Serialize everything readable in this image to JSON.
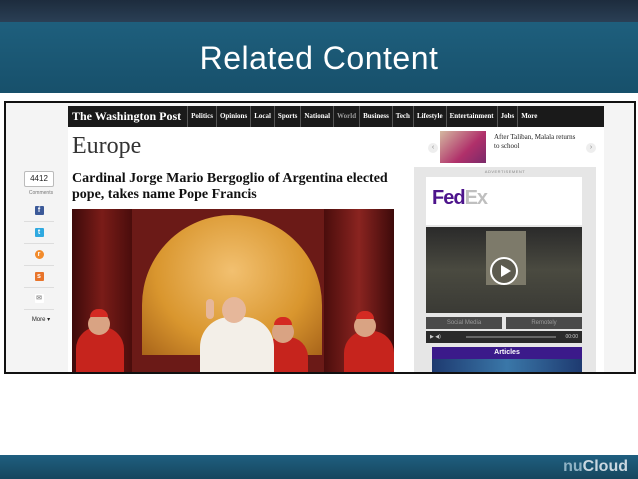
{
  "slide": {
    "title": "Related Content",
    "brand_prefix": "nu",
    "brand_suffix": "Cloud"
  },
  "header": {
    "logo": "The Washington Post",
    "nav": [
      {
        "label": "Politics"
      },
      {
        "label": "Opinions"
      },
      {
        "label": "Local"
      },
      {
        "label": "Sports"
      },
      {
        "label": "National"
      },
      {
        "label": "World"
      },
      {
        "label": "Business"
      },
      {
        "label": "Tech"
      },
      {
        "label": "Lifestyle"
      },
      {
        "label": "Entertainment"
      },
      {
        "label": "Jobs"
      },
      {
        "label": "More"
      }
    ]
  },
  "page": {
    "section": "Europe",
    "headline": "Cardinal Jorge Mario Bergoglio of Argentina elected pope, takes name Pope Francis",
    "promo_text": "After Taliban, Malala returns to school"
  },
  "share": {
    "count": "4412",
    "count_label": "Comments",
    "buttons": [
      {
        "icon": "facebook-icon",
        "glyph": "f",
        "color": "#3b5998"
      },
      {
        "icon": "twitter-icon",
        "glyph": "t",
        "color": "#2fa9e0"
      },
      {
        "icon": "reddit-icon",
        "glyph": "r",
        "color": "#f28b2b"
      },
      {
        "icon": "stumbleupon-icon",
        "glyph": "s",
        "color": "#e8742a"
      },
      {
        "icon": "email-icon",
        "glyph": "✉",
        "color": "#9a9a9a"
      }
    ],
    "more": "More ▾"
  },
  "ad": {
    "label": "ADVERTISEMENT",
    "brand_fed": "Fed",
    "brand_ex": "Ex",
    "tab_left": "Social Media",
    "tab_right": "Remotely",
    "time": "00:00",
    "articles": "Articles"
  }
}
